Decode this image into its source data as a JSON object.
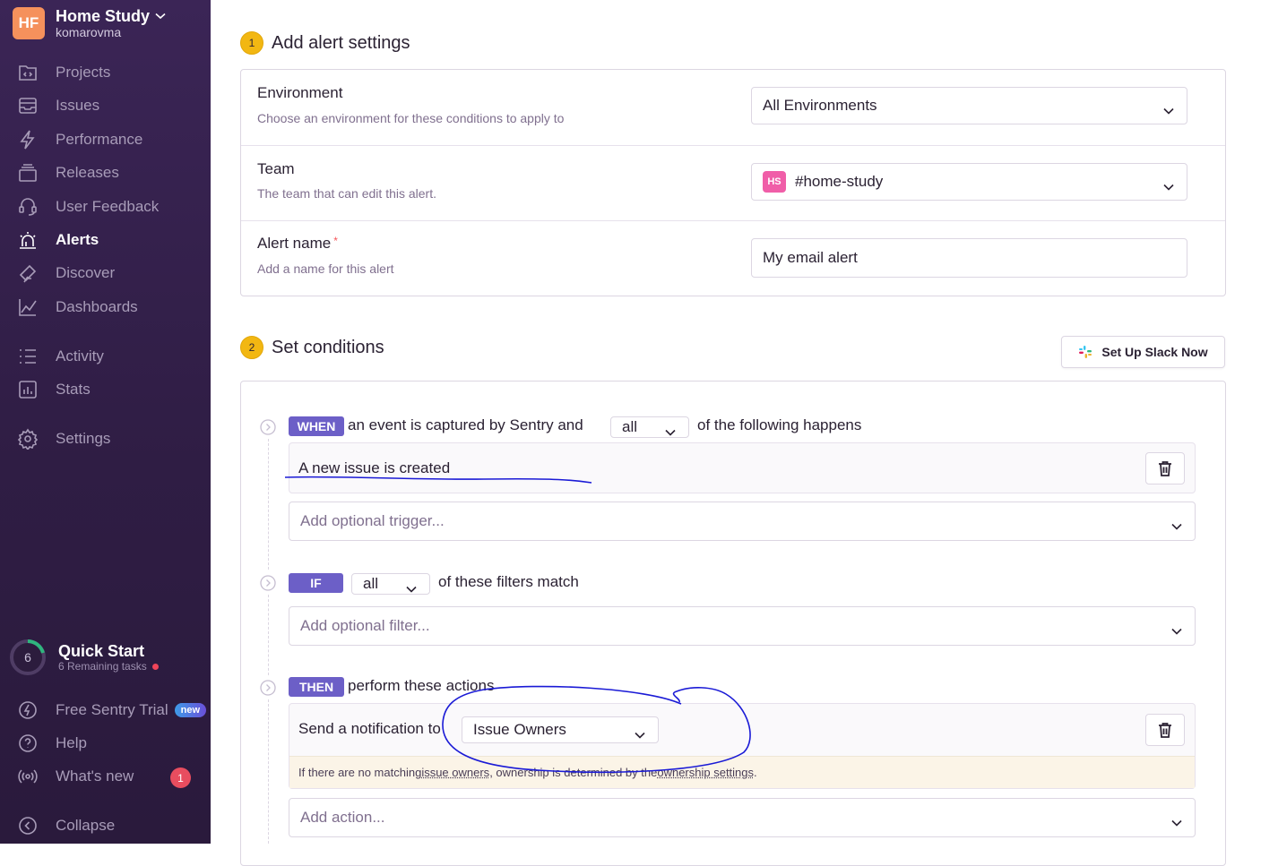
{
  "sidebar": {
    "org": {
      "initials": "HF",
      "name": "Home Study",
      "user": "komarovma"
    },
    "items": [
      {
        "label": "Projects",
        "icon": "projects-icon"
      },
      {
        "label": "Issues",
        "icon": "issues-icon"
      },
      {
        "label": "Performance",
        "icon": "performance-icon"
      },
      {
        "label": "Releases",
        "icon": "releases-icon"
      },
      {
        "label": "User Feedback",
        "icon": "user-feedback-icon"
      },
      {
        "label": "Alerts",
        "icon": "alerts-icon",
        "active": true
      },
      {
        "label": "Discover",
        "icon": "discover-icon"
      },
      {
        "label": "Dashboards",
        "icon": "dashboards-icon"
      },
      {
        "label": "Activity",
        "icon": "activity-icon"
      },
      {
        "label": "Stats",
        "icon": "stats-icon"
      },
      {
        "label": "Settings",
        "icon": "settings-icon"
      }
    ],
    "quick_start": {
      "count": "6",
      "title": "Quick Start",
      "subtitle": "6 Remaining tasks"
    },
    "bottom": [
      {
        "label": "Free Sentry Trial",
        "badge": "new",
        "icon": "lightning-icon"
      },
      {
        "label": "Help",
        "icon": "help-icon"
      },
      {
        "label": "What's new",
        "count": "1",
        "icon": "broadcast-icon"
      },
      {
        "label": "Collapse",
        "icon": "collapse-icon"
      }
    ]
  },
  "step1": {
    "num": "1",
    "title": "Add alert settings",
    "environment": {
      "label": "Environment",
      "help": "Choose an environment for these conditions to apply to",
      "value": "All Environments"
    },
    "team": {
      "label": "Team",
      "help": "The team that can edit this alert.",
      "badge": "HS",
      "value": "#home-study"
    },
    "alert_name": {
      "label": "Alert name",
      "required": "*",
      "help": "Add a name for this alert",
      "value": "My email alert"
    }
  },
  "step2": {
    "num": "2",
    "title": "Set conditions",
    "slack_button": "Set Up Slack Now",
    "when": {
      "tag": "WHEN",
      "text_before": "an event is captured by Sentry and",
      "match": "all",
      "text_after": "of the following happens",
      "rule": "A new issue is created",
      "add_placeholder": "Add optional trigger..."
    },
    "if": {
      "tag": "IF",
      "match": "all",
      "text_after": "of these filters match",
      "add_placeholder": "Add optional filter..."
    },
    "then": {
      "tag": "THEN",
      "text": "perform these actions",
      "action_text": "Send a notification to",
      "action_target": "Issue Owners",
      "note_a": "If there are no matching ",
      "note_link1": "issue owners",
      "note_b": ", ownership is determined by the ",
      "note_link2": "ownership settings",
      "note_c": ".",
      "add_placeholder": "Add action..."
    }
  },
  "colors": {
    "sidebar_bg": "#3b2556",
    "accent": "#6c5fc7",
    "step_badge": "#f2b712",
    "annotation": "#1a1ad6"
  }
}
